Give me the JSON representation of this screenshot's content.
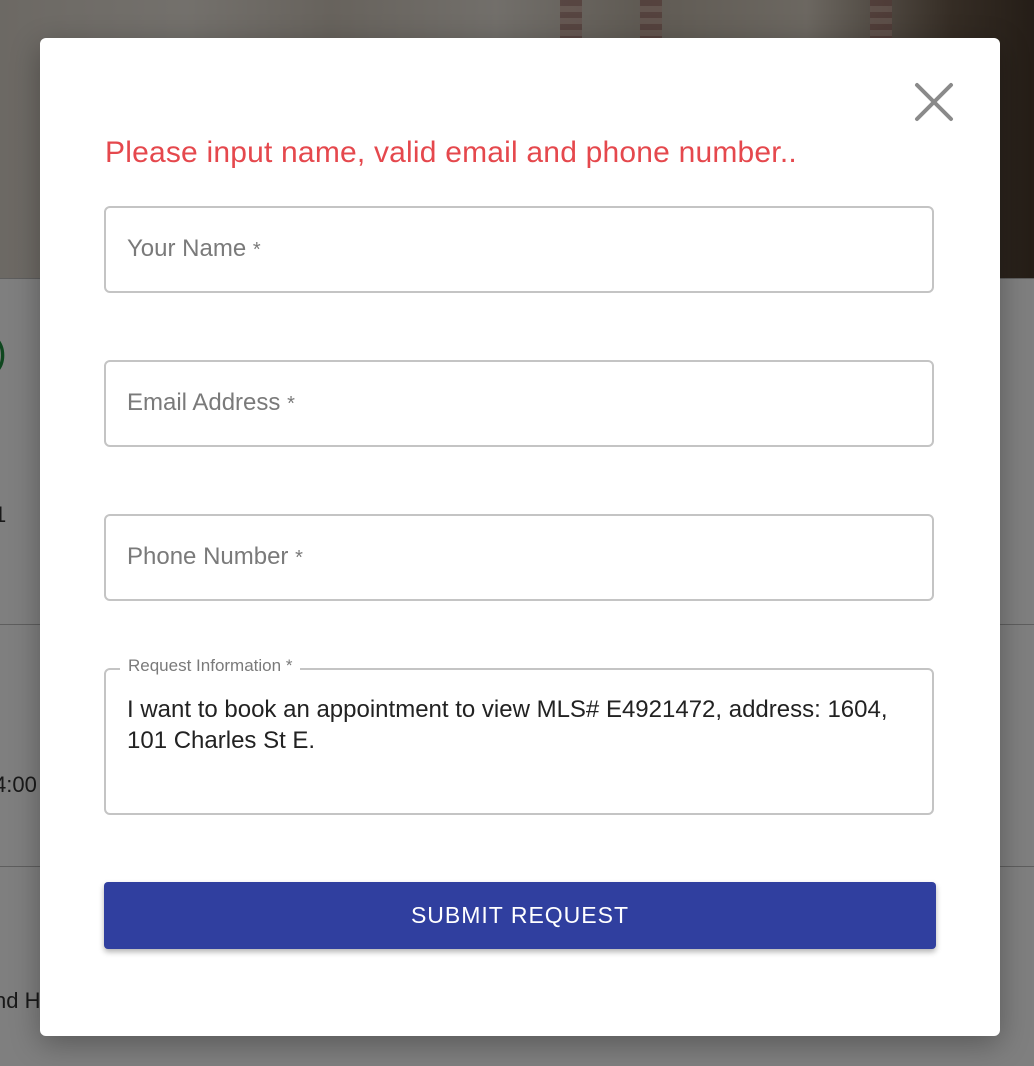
{
  "background": {
    "partial_text_1": ")",
    "partial_text_2": "1",
    "partial_text_3": "4:00",
    "partial_text_4": "nd H"
  },
  "modal": {
    "close_icon": "close-icon",
    "error_message": "Please input name, valid email and phone number..",
    "fields": {
      "name": {
        "label": "Your Name",
        "required": "*",
        "value": ""
      },
      "email": {
        "label": "Email Address",
        "required": "*",
        "value": ""
      },
      "phone": {
        "label": "Phone Number",
        "required": "*",
        "value": ""
      },
      "request": {
        "label": "Request Information",
        "required": "*",
        "value": "I want to book an appointment to view MLS# E4921472, address: 1604, 101 Charles St E."
      }
    },
    "submit_label": "SUBMIT REQUEST"
  },
  "colors": {
    "error": "#e5484d",
    "primary_button": "#303f9f",
    "field_border": "#c4c4c4"
  }
}
